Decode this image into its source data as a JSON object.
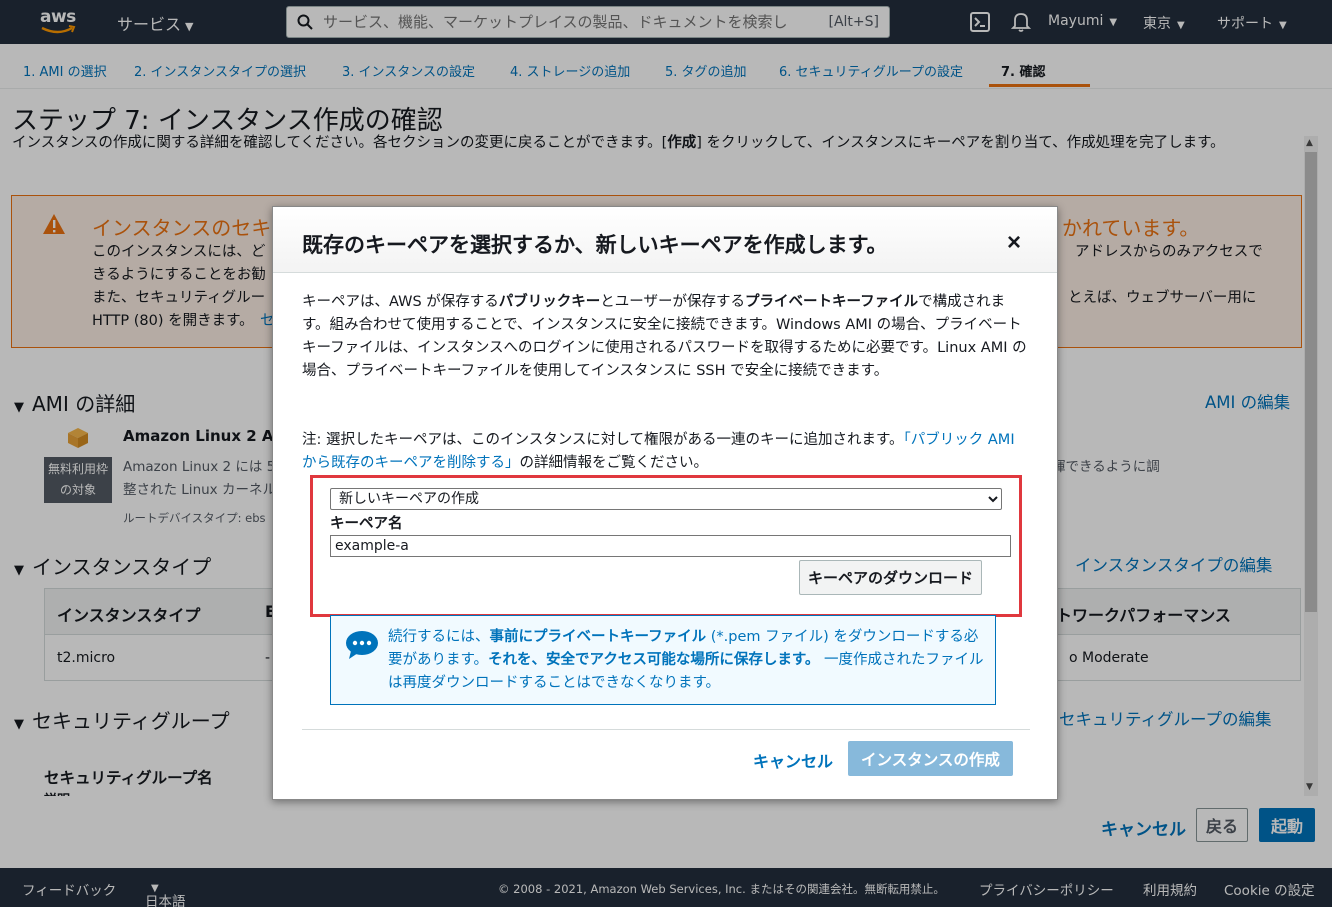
{
  "topnav": {
    "logo_text": "aws",
    "services": "サービス",
    "search_placeholder": "サービス、機能、マーケットプレイスの製品、ドキュメントを検索し",
    "search_shortcut": "[Alt+S]",
    "user": "Mayumi",
    "region": "東京",
    "support": "サポート"
  },
  "tabs": [
    {
      "label": "1. AMI の選択"
    },
    {
      "label": "2. インスタンスタイプの選択"
    },
    {
      "label": "3. インスタンスの設定"
    },
    {
      "label": "4. ストレージの追加"
    },
    {
      "label": "5. タグの追加"
    },
    {
      "label": "6. セキュリティグループの設定"
    },
    {
      "label": "7. 確認"
    }
  ],
  "page": {
    "title": "ステップ 7: インスタンス作成の確認",
    "desc_pre": "インスタンスの作成に関する詳細を確認してください。各セクションの変更に戻ることができます。[",
    "desc_bold": "作成",
    "desc_post": "] をクリックして、インスタンスにキーペアを割り当て、作成処理を完了します。"
  },
  "warning": {
    "title_left": "インスタンスのセキュ",
    "title_right": "かれています。",
    "line1_left": "このインスタンスには、ど",
    "line1_right": "アドレスからのみアクセスで",
    "line2_left": "きるようにすることをお勧",
    "line3_left": "また、セキュリティグルー",
    "line3_right": "とえば、ウェブサーバー用に",
    "line4_left": "HTTP (80) を開きます。",
    "line4_link": "セ"
  },
  "ami": {
    "section": "AMI の詳細",
    "edit": "AMI の編集",
    "free_tier_1": "無料利用枠",
    "free_tier_2": "の対象",
    "name": "Amazon Linux 2 AM",
    "line1_left": "Amazon Linux 2 には 5 年",
    "line1_right": "揮できるように調",
    "line2": "整された Linux カーネル",
    "line3": "ルートデバイスタイプ: ebs"
  },
  "instance_type": {
    "section": "インスタンスタイプ",
    "edit": "インスタンスタイプの編集",
    "col1": "インスタンスタイプ",
    "col2": "E",
    "col_last": "トワークパフォーマンス",
    "row_type": "t2.micro",
    "row_col2": "-",
    "row_last": "o Moderate"
  },
  "security_group": {
    "section": "セキュリティグループ",
    "edit": "セキュリティグループの編集",
    "name_label": "セキュリティグループ名",
    "desc_label": "説明"
  },
  "bottom": {
    "cancel": "キャンセル",
    "back": "戻る",
    "launch": "起動"
  },
  "footer": {
    "feedback": "フィードバック",
    "language": "日本語",
    "copyright": "© 2008 - 2021, Amazon Web Services, Inc. またはその関連会社。無断転用禁止。",
    "privacy": "プライバシーポリシー",
    "terms": "利用規約",
    "cookie": "Cookie の設定"
  },
  "modal": {
    "title": "既存のキーペアを選択するか、新しいキーペアを作成します。",
    "close": "×",
    "body_1": "キーペアは、AWS が保存する",
    "body_b1": "パブリックキー",
    "body_2": "とユーザーが保存する",
    "body_b2": "プライベートキーファイル",
    "body_3": "で構成されます。組み合わせて使用することで、インスタンスに安全に接続できます。Windows AMI の場合、プライベートキーファイルは、インスタンスへのログインに使用されるパスワードを取得するために必要です。Linux AMI の場合、プライベートキーファイルを使用してインスタンスに SSH で安全に接続できます。",
    "note_pre": "注: 選択したキーペアは、このインスタンスに対して権限がある一連のキーに追加されます。",
    "note_link": "「パブリック AMI から既存のキーペアを削除する」",
    "note_post": "の詳細情報をご覧ください。",
    "select_value": "新しいキーペアの作成",
    "keypair_label": "キーペア名",
    "keypair_value": "example-a",
    "download": "キーペアのダウンロード",
    "info_1": "続行するには、",
    "info_b1": "事前にプライベートキーファイル",
    "info_2": " (*.pem ファイル) をダウンロードする必要があります。",
    "info_b2": "それを、安全でアクセス可能な場所に保存します。",
    "info_3": " 一度作成されたファイルは再度ダウンロードすることはできなくなります。",
    "cancel": "キャンセル",
    "create": "インスタンスの作成"
  }
}
